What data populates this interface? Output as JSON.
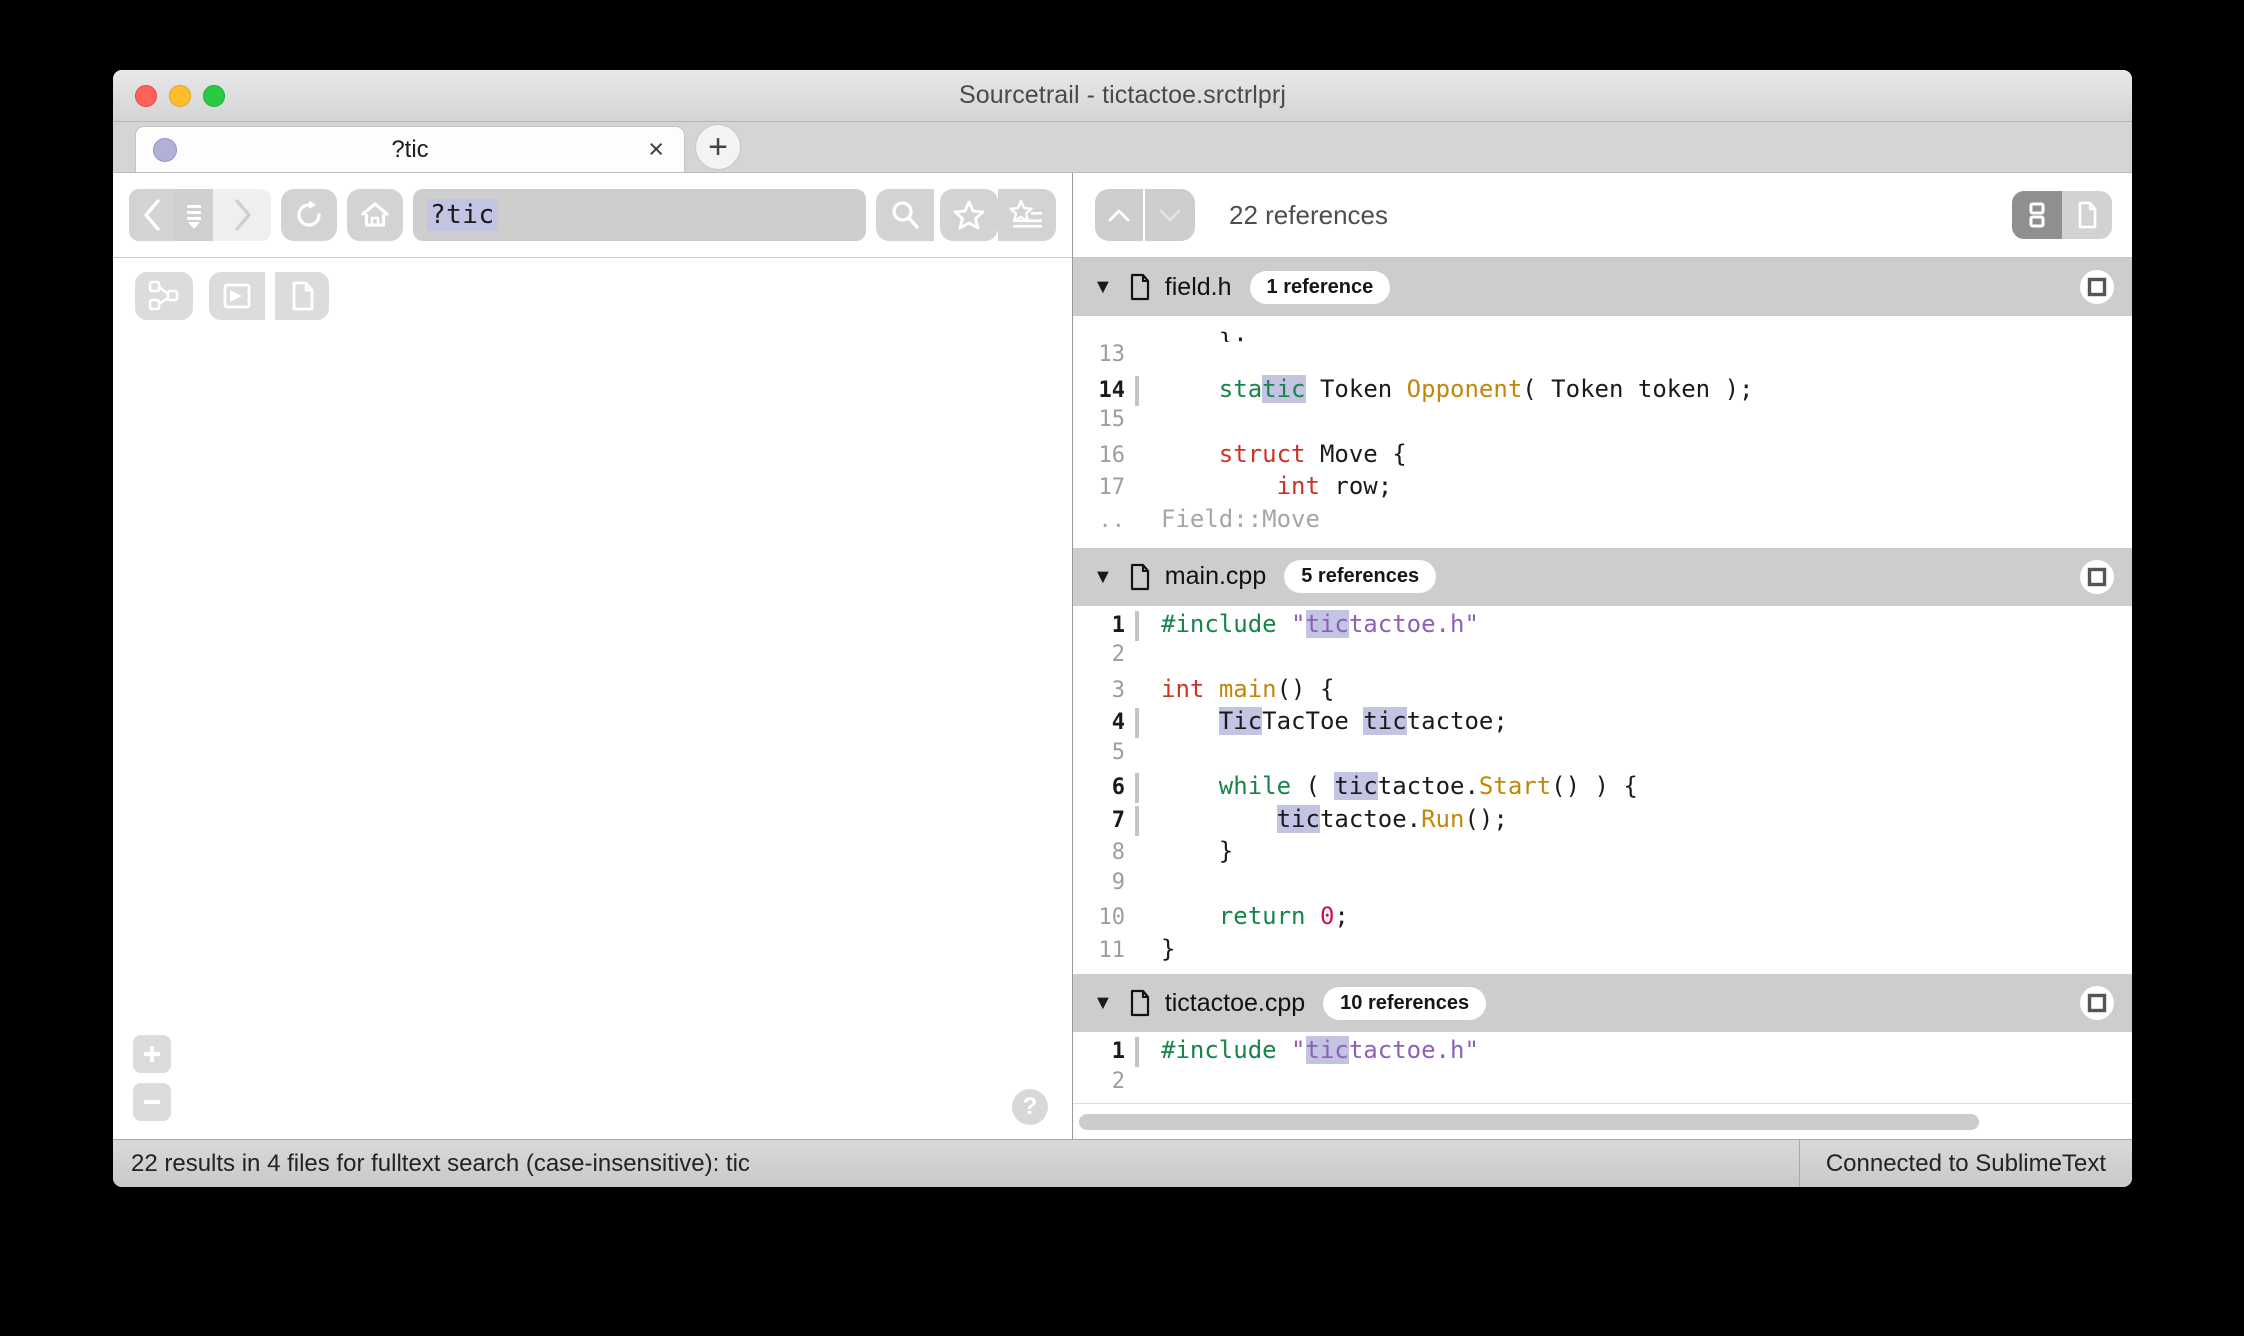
{
  "window": {
    "title": "Sourcetrail - tictactoe.srctrlprj",
    "traffic_lights": [
      "close-red",
      "minimize-yellow",
      "maximize-green"
    ]
  },
  "tabs": {
    "items": [
      {
        "label": "?tic",
        "indicator_color": "#b0b0d8",
        "close_label": "×",
        "active": true
      }
    ],
    "new_tab_label": "+"
  },
  "toolbar": {
    "back_icon": "chevron-left-icon",
    "history_icon": "history-dropdown-icon",
    "forward_icon": "chevron-right-icon",
    "refresh_icon": "refresh-icon",
    "home_icon": "home-icon",
    "search_value": "?tic",
    "search_placeholder": "",
    "search_icon": "magnifier-icon",
    "bookmark_icon": "star-icon",
    "bookmark_list_icon": "star-list-icon"
  },
  "view_toolbar": {
    "graph_icon": "graph-nodes-icon",
    "trail_icon": "custom-trail-icon",
    "code_icon": "code-file-icon"
  },
  "canvas": {
    "zoom_in_label": "+",
    "zoom_out_label": "−",
    "help_label": "?"
  },
  "references": {
    "prev_icon": "chevron-up-icon",
    "next_icon": "chevron-down-icon",
    "count_label": "22 references",
    "view_list_icon": "snippet-list-icon",
    "view_file_icon": "single-file-icon"
  },
  "accent_colors": {
    "keyword_green": "#17854a",
    "function_gold": "#c2870a",
    "type_red": "#cc3322",
    "string_purple": "#8d60b8",
    "number_crimson": "#cc1155",
    "match_highlight": "#c3c3e4",
    "file_header_bg": "#cdcdcd"
  },
  "files": [
    {
      "name": "field.h",
      "badge": "1 reference",
      "expanded": true,
      "maximize_icon": "maximize-snippet-icon",
      "clipped_top": "};",
      "lines": [
        {
          "no": "13",
          "active": false,
          "tokens": []
        },
        {
          "no": "14",
          "active": true,
          "tokens": [
            {
              "t": "    ",
              "c": "ctext"
            },
            {
              "t": "sta",
              "c": "kw"
            },
            {
              "t": "tic",
              "c": "kw hl"
            },
            {
              "t": " ",
              "c": "ctext"
            },
            {
              "t": "Token",
              "c": "typ"
            },
            {
              "t": " ",
              "c": "ctext"
            },
            {
              "t": "Opponent",
              "c": "fn"
            },
            {
              "t": "( ",
              "c": "ctext"
            },
            {
              "t": "Token",
              "c": "typ"
            },
            {
              "t": " token );",
              "c": "ctext"
            }
          ]
        },
        {
          "no": "15",
          "active": false,
          "tokens": []
        },
        {
          "no": "16",
          "active": false,
          "tokens": [
            {
              "t": "    ",
              "c": "ctext"
            },
            {
              "t": "struct",
              "c": "kw2"
            },
            {
              "t": " Move {",
              "c": "ctext"
            }
          ]
        },
        {
          "no": "17",
          "active": false,
          "tokens": [
            {
              "t": "        ",
              "c": "ctext"
            },
            {
              "t": "int",
              "c": "kw2"
            },
            {
              "t": " row;",
              "c": "ctext"
            }
          ]
        }
      ],
      "footer": {
        "no": "..",
        "label": "Field::Move"
      }
    },
    {
      "name": "main.cpp",
      "badge": "5 references",
      "expanded": true,
      "maximize_icon": "maximize-snippet-icon",
      "lines": [
        {
          "no": "1",
          "active": true,
          "tokens": [
            {
              "t": "#include",
              "c": "kw"
            },
            {
              "t": " ",
              "c": "ctext"
            },
            {
              "t": "\"",
              "c": "str"
            },
            {
              "t": "tic",
              "c": "str hl"
            },
            {
              "t": "tactoe.h\"",
              "c": "str"
            }
          ]
        },
        {
          "no": "2",
          "active": false,
          "tokens": []
        },
        {
          "no": "3",
          "active": false,
          "tokens": [
            {
              "t": "int",
              "c": "kw2"
            },
            {
              "t": " ",
              "c": "ctext"
            },
            {
              "t": "main",
              "c": "fn"
            },
            {
              "t": "() {",
              "c": "ctext"
            }
          ]
        },
        {
          "no": "4",
          "active": true,
          "tokens": [
            {
              "t": "    ",
              "c": "ctext"
            },
            {
              "t": "Tic",
              "c": "typ hl"
            },
            {
              "t": "TacToe ",
              "c": "typ"
            },
            {
              "t": "tic",
              "c": "ctext hl"
            },
            {
              "t": "tactoe;",
              "c": "ctext"
            }
          ]
        },
        {
          "no": "5",
          "active": false,
          "tokens": []
        },
        {
          "no": "6",
          "active": true,
          "tokens": [
            {
              "t": "    ",
              "c": "ctext"
            },
            {
              "t": "while",
              "c": "kw"
            },
            {
              "t": " ( ",
              "c": "ctext"
            },
            {
              "t": "tic",
              "c": "ctext hl"
            },
            {
              "t": "tactoe.",
              "c": "ctext"
            },
            {
              "t": "Start",
              "c": "fn"
            },
            {
              "t": "() ) {",
              "c": "ctext"
            }
          ]
        },
        {
          "no": "7",
          "active": true,
          "tokens": [
            {
              "t": "        ",
              "c": "ctext"
            },
            {
              "t": "tic",
              "c": "ctext hl"
            },
            {
              "t": "tactoe.",
              "c": "ctext"
            },
            {
              "t": "Run",
              "c": "fn"
            },
            {
              "t": "();",
              "c": "ctext"
            }
          ]
        },
        {
          "no": "8",
          "active": false,
          "tokens": [
            {
              "t": "    }",
              "c": "ctext"
            }
          ]
        },
        {
          "no": "9",
          "active": false,
          "tokens": []
        },
        {
          "no": "10",
          "active": false,
          "tokens": [
            {
              "t": "    ",
              "c": "ctext"
            },
            {
              "t": "return",
              "c": "kw"
            },
            {
              "t": " ",
              "c": "ctext"
            },
            {
              "t": "0",
              "c": "num"
            },
            {
              "t": ";",
              "c": "ctext"
            }
          ]
        },
        {
          "no": "11",
          "active": false,
          "tokens": [
            {
              "t": "}",
              "c": "ctext"
            }
          ]
        }
      ]
    },
    {
      "name": "tictactoe.cpp",
      "badge": "10 references",
      "expanded": true,
      "maximize_icon": "maximize-snippet-icon",
      "lines": [
        {
          "no": "1",
          "active": true,
          "tokens": [
            {
              "t": "#include",
              "c": "kw"
            },
            {
              "t": " ",
              "c": "ctext"
            },
            {
              "t": "\"",
              "c": "str"
            },
            {
              "t": "tic",
              "c": "str hl"
            },
            {
              "t": "tactoe.h\"",
              "c": "str"
            }
          ]
        },
        {
          "no": "2",
          "active": false,
          "tokens": []
        }
      ]
    }
  ],
  "statusbar": {
    "message": "22 results in 4 files for fulltext search (case-insensitive): tic",
    "connection": "Connected to SublimeText"
  }
}
